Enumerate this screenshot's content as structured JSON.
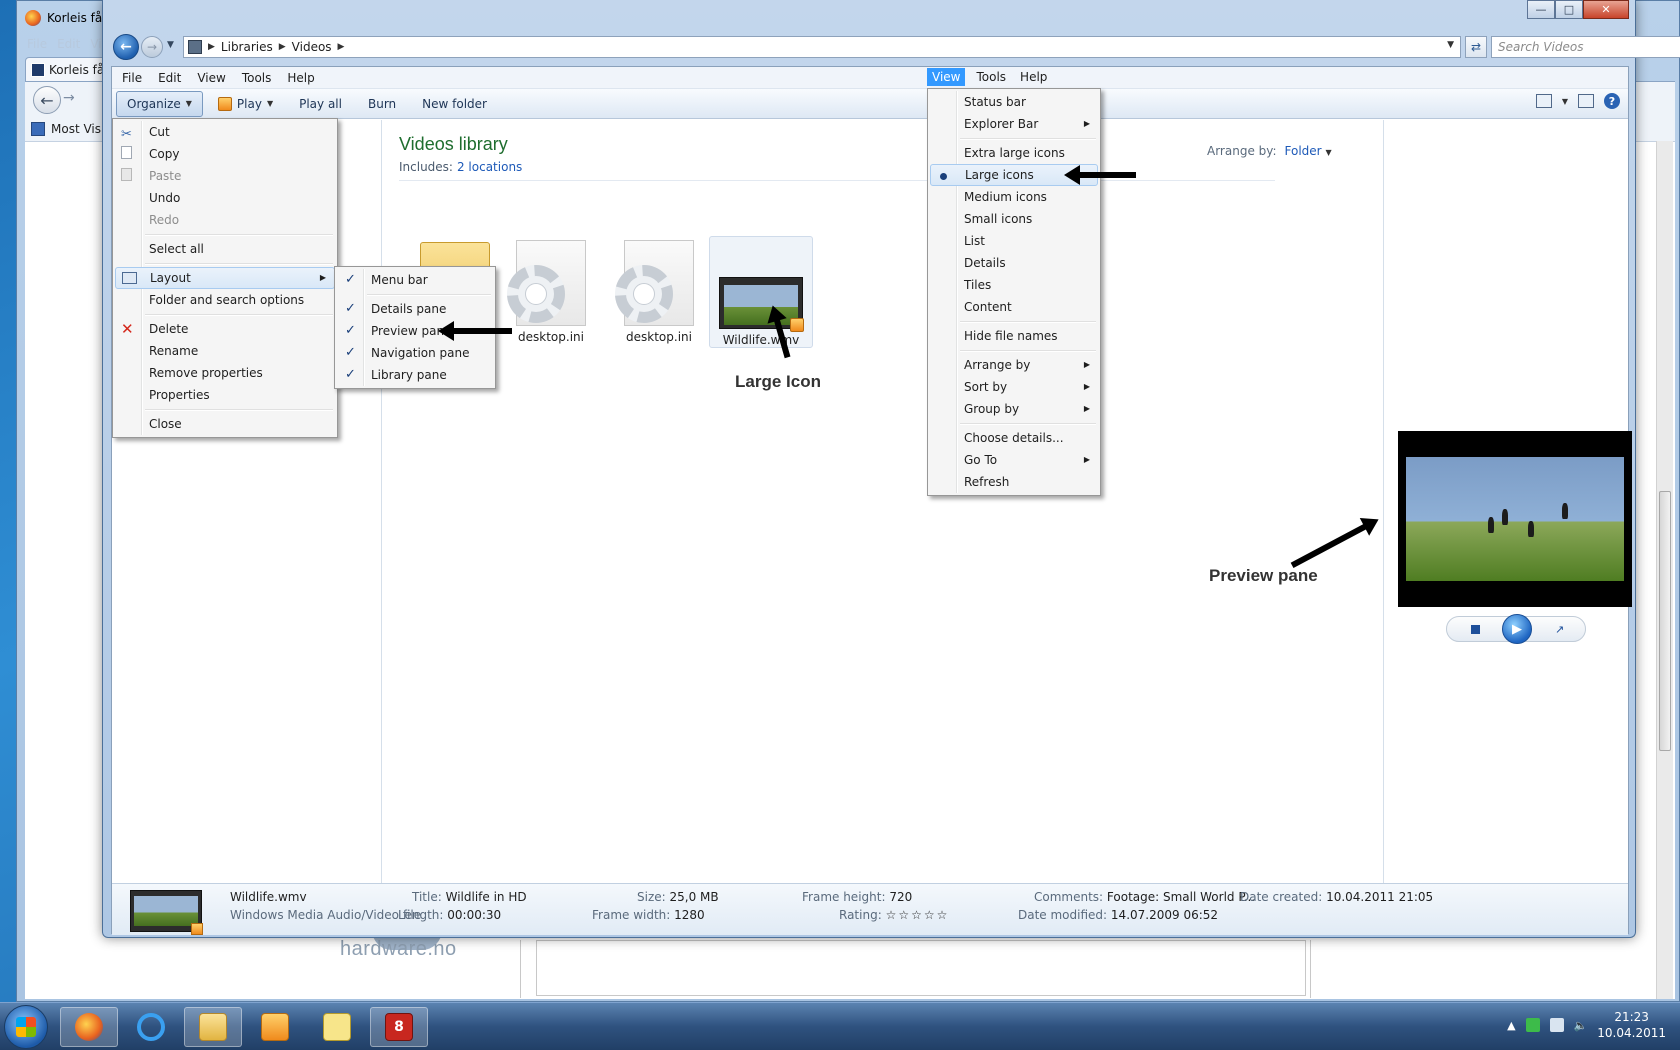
{
  "firefox": {
    "title": "Korleis få fr",
    "menu": [
      "File",
      "Edit",
      "Vi"
    ],
    "tab_label": "Korleis få",
    "bookmark": "Most Visite",
    "site_logo": "hardware.no"
  },
  "explorer": {
    "breadcrumb": [
      "Libraries",
      "Videos"
    ],
    "search_placeholder": "Search Videos",
    "menubar": [
      "File",
      "Edit",
      "View",
      "Tools",
      "Help"
    ],
    "toolbar": {
      "organize": "Organize",
      "play": "Play",
      "play_all": "Play all",
      "burn": "Burn",
      "new_folder": "New folder"
    },
    "library": {
      "title": "Videos library",
      "includes_label": "Includes:",
      "includes_link": "2 locations",
      "arrange_label": "Arrange by:",
      "arrange_value": "Folder"
    },
    "files": [
      {
        "name": ""
      },
      {
        "name": "desktop.ini"
      },
      {
        "name": "desktop.ini"
      },
      {
        "name": "Wildlife.wmv"
      }
    ],
    "annotations": {
      "large_icon": "Large Icon",
      "preview_pane": "Preview pane"
    },
    "details": {
      "filename": "Wildlife.wmv",
      "filetype": "Windows Media Audio/Video file",
      "title_k": "Title:",
      "title_v": "Wildlife in HD",
      "length_k": "Length:",
      "length_v": "00:00:30",
      "size_k": "Size:",
      "size_v": "25,0 MB",
      "fwidth_k": "Frame width:",
      "fwidth_v": "1280",
      "fheight_k": "Frame height:",
      "fheight_v": "720",
      "rating_k": "Rating:",
      "rating_v": "☆☆☆☆☆",
      "comments_k": "Comments:",
      "comments_v": "Footage: Small World P...",
      "modified_k": "Date modified:",
      "modified_v": "14.07.2009 06:52",
      "created_k": "Date created:",
      "created_v": "10.04.2011 21:05"
    }
  },
  "organize_menu": {
    "items": [
      "Cut",
      "Copy",
      "Paste",
      "Undo",
      "Redo",
      "Select all",
      "Layout",
      "Folder and search options",
      "Delete",
      "Rename",
      "Remove properties",
      "Properties",
      "Close"
    ]
  },
  "layout_menu": {
    "items": [
      "Menu bar",
      "Details pane",
      "Preview pane",
      "Navigation pane",
      "Library pane"
    ]
  },
  "view_menu": {
    "header": [
      "View",
      "Tools",
      "Help"
    ],
    "items": [
      "Status bar",
      "Explorer Bar",
      "Extra large icons",
      "Large icons",
      "Medium icons",
      "Small icons",
      "List",
      "Details",
      "Tiles",
      "Content",
      "Hide file names",
      "Arrange by",
      "Sort by",
      "Group by",
      "Choose details...",
      "Go To",
      "Refresh"
    ]
  },
  "taskbar": {
    "time": "21:23",
    "date": "10.04.2011",
    "psp_badge": "8"
  }
}
